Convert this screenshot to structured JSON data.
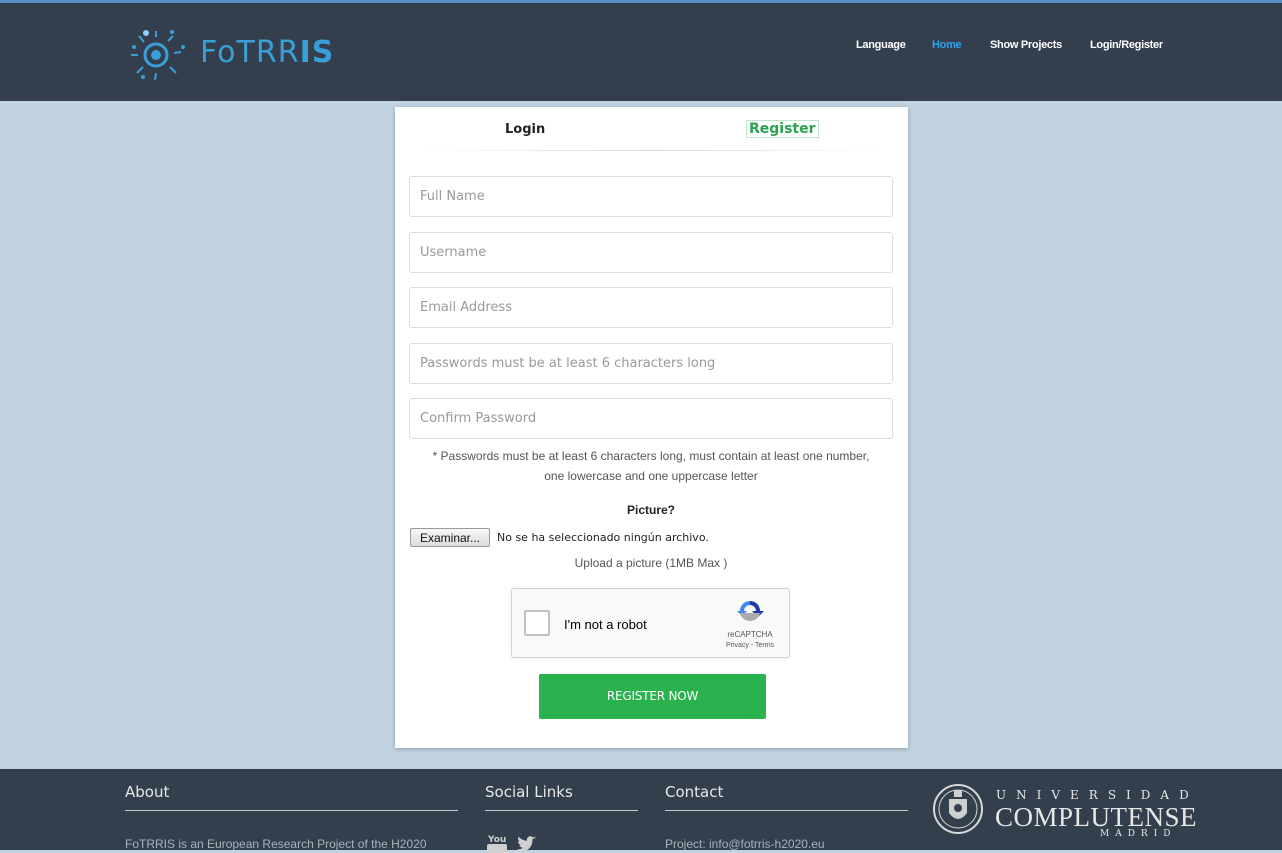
{
  "brand": {
    "name_main": "FoTRR",
    "name_accent": "IS"
  },
  "nav": {
    "language": "Language",
    "home": "Home",
    "show_projects": "Show Projects",
    "login_register": "Login/Register"
  },
  "tabs": {
    "login": "Login",
    "register": "Register"
  },
  "form": {
    "full_name_placeholder": "Full Name",
    "username_placeholder": "Username",
    "email_placeholder": "Email Address",
    "password_placeholder": "Passwords must be at least 6 characters long",
    "confirm_password_placeholder": "Confirm Password",
    "password_note_line1": "* Passwords must be at least 6 characters long, must contain at least one number,",
    "password_note_line2": "one lowercase and one uppercase letter",
    "picture_label": "Picture?",
    "browse_button": "Examinar...",
    "no_file_text": "No se ha seleccionado ningún archivo.",
    "upload_hint": "Upload a picture (1MB Max )",
    "captcha_label": "I'm not a robot",
    "captcha_brand": "reCAPTCHA",
    "captcha_terms": "Privacy - Terms",
    "submit_label": "REGISTER NOW"
  },
  "footer": {
    "about_heading": "About",
    "about_text": "FoTRRIS is an European Research Project of the H2020",
    "social_heading": "Social Links",
    "contact_heading": "Contact",
    "contact_text": "Project: info@fotrris-h2020.eu",
    "university_top": "UNIVERSIDAD",
    "university_main": "COMPLUTENSE",
    "university_sub": "MADRID"
  },
  "colors": {
    "topbar": "#343f4e",
    "accent": "#2ea3f2",
    "register_green": "#2ab24f",
    "background": "#c1d3e1"
  }
}
